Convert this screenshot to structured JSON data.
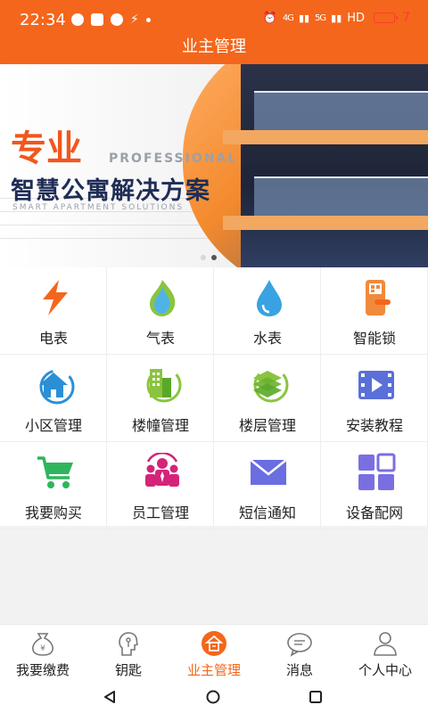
{
  "status_bar": {
    "time": "22:34",
    "network": "4G",
    "signal2": "5G",
    "hd": "HD",
    "battery": "7"
  },
  "header": {
    "title": "业主管理"
  },
  "banner": {
    "headline": "专业",
    "professional": "PROFESSIONAL",
    "tagline": "智慧公寓解决方案",
    "subtitle": "SMART APARTMENT SOLUTIONS"
  },
  "grid": {
    "items": [
      {
        "label": "电表",
        "icon": "lightning-icon"
      },
      {
        "label": "气表",
        "icon": "gas-flame-icon"
      },
      {
        "label": "水表",
        "icon": "water-drop-icon"
      },
      {
        "label": "智能锁",
        "icon": "smart-lock-icon"
      },
      {
        "label": "小区管理",
        "icon": "community-house-icon"
      },
      {
        "label": "楼幢管理",
        "icon": "building-icon"
      },
      {
        "label": "楼层管理",
        "icon": "floor-layers-icon"
      },
      {
        "label": "安装教程",
        "icon": "video-tutorial-icon"
      },
      {
        "label": "我要购买",
        "icon": "shopping-cart-icon"
      },
      {
        "label": "员工管理",
        "icon": "staff-group-icon"
      },
      {
        "label": "短信通知",
        "icon": "envelope-icon"
      },
      {
        "label": "设备配网",
        "icon": "device-network-icon"
      }
    ]
  },
  "bottom_nav": {
    "items": [
      {
        "label": "我要缴费",
        "icon": "payment-bag-icon"
      },
      {
        "label": "钥匙",
        "icon": "key-profile-icon"
      },
      {
        "label": "业主管理",
        "icon": "owner-management-icon"
      },
      {
        "label": "消息",
        "icon": "message-icon"
      },
      {
        "label": "个人中心",
        "icon": "person-icon"
      }
    ],
    "active_index": 2
  },
  "colors": {
    "brand": "#f4661b",
    "banner_headline": "#f2561c",
    "banner_tagline": "#1f2d56"
  }
}
